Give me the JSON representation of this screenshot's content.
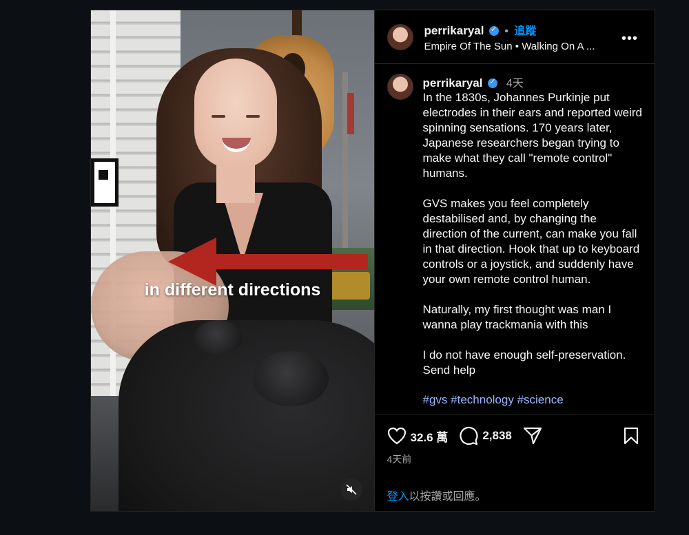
{
  "header": {
    "username": "perrikaryal",
    "follow_label": "追蹤",
    "audio": "Empire Of The Sun • Walking On A ...",
    "more_label": "•••"
  },
  "video": {
    "caption_overlay": "in different directions"
  },
  "caption": {
    "username": "perrikaryal",
    "time": "4天",
    "text": "In the 1830s, Johannes Purkinje put electrodes in their ears and reported weird spinning sensations. 170 years later, Japanese researchers began trying to make what they call \"remote control\" humans.\n\nGVS makes you feel completely destabilised and, by changing the direction of the current, can make you fall in that direction. Hook that up to keyboard controls or a joystick, and suddenly have your own remote control human.\n\nNaturally, my first thought was man I wanna play trackmania with this\n\nI do not have enough self-preservation. Send help",
    "tags": [
      "#gvs",
      "#technology",
      "#science"
    ]
  },
  "actions": {
    "likes": "32.6 萬",
    "comments": "2,838",
    "date": "4天前"
  },
  "login": {
    "link": "登入",
    "rest": "以按讚或回應。"
  }
}
